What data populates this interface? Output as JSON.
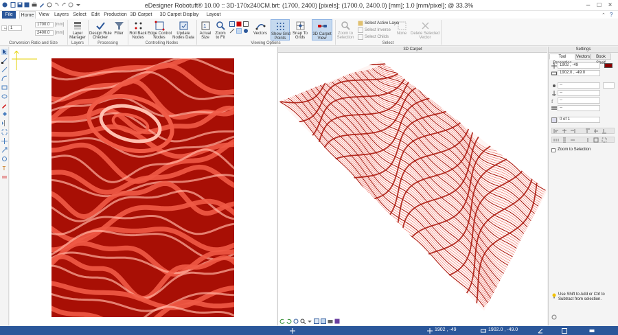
{
  "app": {
    "title": "eDesigner Robotuft® 10.00 :: 3D-170x240CM.brt: (1700, 2400) [pixels]; (1700.0, 2400.0) [mm]; 1.0 [mm/pixel]; @ 33.3%"
  },
  "tabs": [
    "File",
    "Home",
    "View",
    "Layers",
    "Select",
    "Edit",
    "Production",
    "3D Carpet",
    "3D Carpet Display Settings",
    "Layout"
  ],
  "ribbon": {
    "conversion": {
      "value1": "1",
      "width": "1700.0",
      "height": "2400.0",
      "unit": "[mm]",
      "label": "Conversion Ratio and Size"
    },
    "layers": {
      "manager": "Layer\nManager",
      "label": "Layers"
    },
    "processing": {
      "drc": "Design Rule\nChecker",
      "filter": "Filter",
      "label": "Processing"
    },
    "controlling": {
      "rollback": "Roll Back\nNodes",
      "edge": "Edge Control\nNodes",
      "update": "Update\nNodes Data",
      "label": "Controlling Nodes"
    },
    "viewing": {
      "actual": "Actual\nSize",
      "zoom_fit": "Zoom\nto Fit",
      "vectors": "Vectors",
      "grid_points": "Show Grid\nPoints",
      "snap": "Snap To\nGrids",
      "carpet_view": "3D Carpet\nView",
      "label": "Viewing Options"
    },
    "select": {
      "zoom_sel": "Zoom to\nSelection",
      "active_layer": "Select Active Layer",
      "inverse": "Select Inverse",
      "childs": "Select Childs",
      "none": "None",
      "delete": "Delete Selected\nVector",
      "label": "Select"
    }
  },
  "canvas3d": {
    "title": "3D Carpet"
  },
  "settings": {
    "title": "Settings",
    "tabs": [
      "Tool Properties",
      "Vectors",
      "Book Shelf"
    ],
    "pos1": "1902 , -49",
    "pos2": "1902.0 , -49.0",
    "f1": "--",
    "f2": "--",
    "f3": "--",
    "f4": "--",
    "f5": "--",
    "of": "0 of 1",
    "zoom_sel": "Zoom to Selection",
    "hint": "Use Shift to Add or Ctrl to Subtract from selection."
  },
  "status": {
    "coord1": "1902 , -49",
    "coord2": "1902.0 , -49.0"
  },
  "colors": {
    "accent": "#2b579a",
    "carpet_dark": "#a80f05",
    "carpet_light": "#f05a46"
  }
}
